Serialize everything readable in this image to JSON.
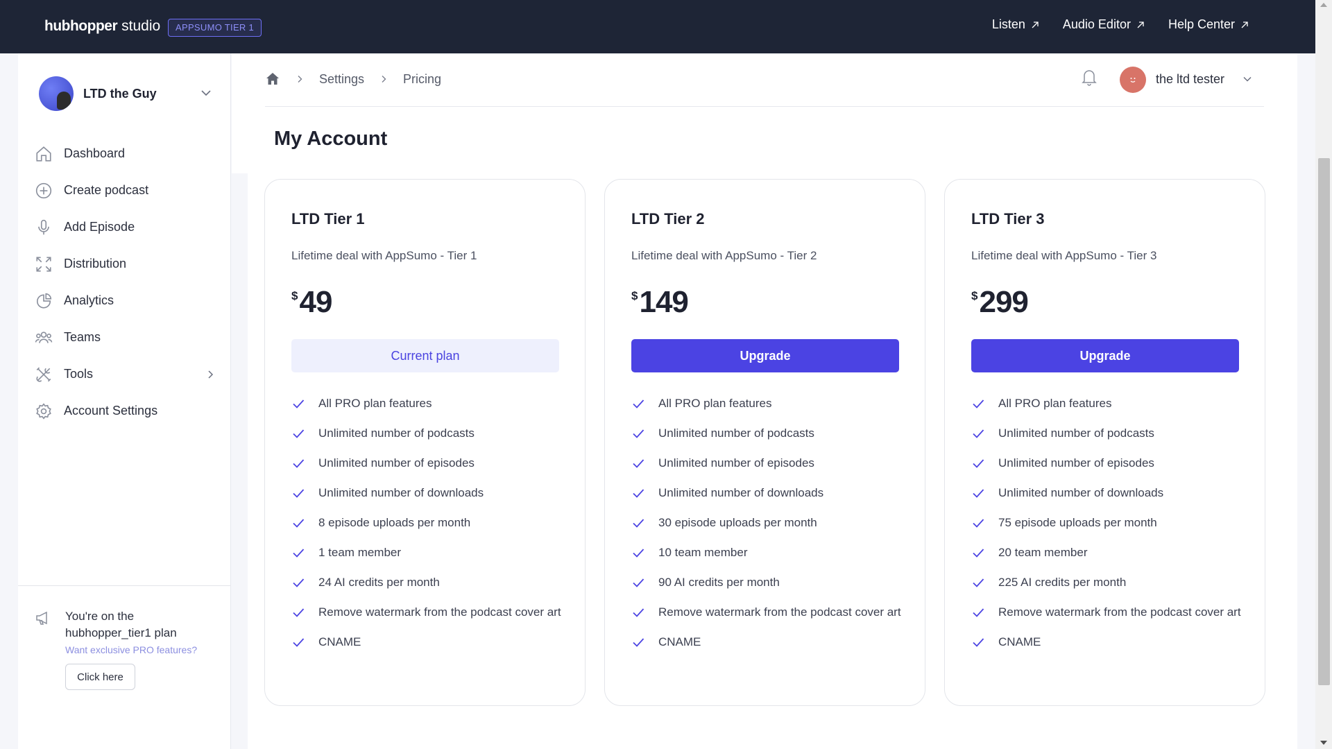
{
  "topbar": {
    "brand_bold": "hubhopper",
    "brand_light": "studio",
    "tier_badge": "APPSUMO TIER 1",
    "links": [
      {
        "label": "Listen"
      },
      {
        "label": "Audio Editor"
      },
      {
        "label": "Help Center"
      }
    ]
  },
  "sidebar": {
    "profile_name": "LTD the Guy",
    "items": [
      {
        "label": "Dashboard",
        "icon": "home-icon"
      },
      {
        "label": "Create podcast",
        "icon": "plus-circle-icon"
      },
      {
        "label": "Add Episode",
        "icon": "microphone-icon"
      },
      {
        "label": "Distribution",
        "icon": "expand-arrows-icon"
      },
      {
        "label": "Analytics",
        "icon": "pie-chart-icon"
      },
      {
        "label": "Teams",
        "icon": "users-icon"
      },
      {
        "label": "Tools",
        "icon": "tools-icon"
      },
      {
        "label": "Account Settings",
        "icon": "gear-icon"
      }
    ],
    "plan_text": "You're on the hubhopper_tier1 plan",
    "plan_sub": "Want exclusive PRO features?",
    "click_here": "Click here"
  },
  "header": {
    "breadcrumb": [
      "Settings",
      "Pricing"
    ],
    "user_name": "the ltd tester",
    "page_title": "My Account"
  },
  "colors": {
    "accent": "#4b43e3",
    "topbar": "#1e2536",
    "check": "#4b43e3"
  },
  "cards": [
    {
      "title": "LTD Tier 1",
      "desc": "Lifetime deal with AppSumo - Tier 1",
      "currency": "$",
      "price": "49",
      "button": "Current plan",
      "features": [
        "All PRO plan features",
        "Unlimited number of podcasts",
        "Unlimited number of episodes",
        "Unlimited number of downloads",
        "8 episode uploads per month",
        "1 team member",
        "24 AI credits per month",
        "Remove watermark from the podcast cover art",
        "CNAME"
      ]
    },
    {
      "title": "LTD Tier 2",
      "desc": "Lifetime deal with AppSumo - Tier 2",
      "currency": "$",
      "price": "149",
      "button": "Upgrade",
      "features": [
        "All PRO plan features",
        "Unlimited number of podcasts",
        "Unlimited number of episodes",
        "Unlimited number of downloads",
        "30 episode uploads per month",
        "10 team member",
        "90 AI credits per month",
        "Remove watermark from the podcast cover art",
        "CNAME"
      ]
    },
    {
      "title": "LTD Tier 3",
      "desc": "Lifetime deal with AppSumo - Tier 3",
      "currency": "$",
      "price": "299",
      "button": "Upgrade",
      "features": [
        "All PRO plan features",
        "Unlimited number of podcasts",
        "Unlimited number of episodes",
        "Unlimited number of downloads",
        "75 episode uploads per month",
        "20 team member",
        "225 AI credits per month",
        "Remove watermark from the podcast cover art",
        "CNAME"
      ]
    }
  ]
}
